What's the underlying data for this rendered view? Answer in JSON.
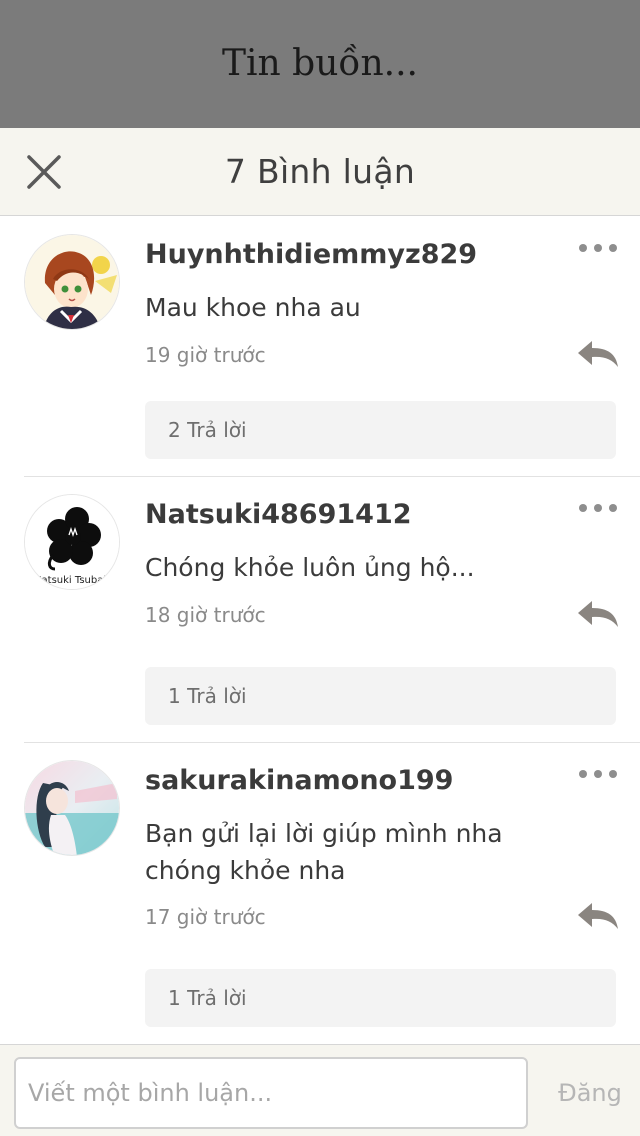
{
  "story": {
    "title": "Tin buồn..."
  },
  "comments_header": {
    "title": "7 Bình luận",
    "close_icon": "close-icon"
  },
  "comments": [
    {
      "username": "Huynhthidiemmyz829",
      "text": "Mau khoe nha au",
      "time": "19 giờ trước",
      "replies_label": "2 Trả lời"
    },
    {
      "username": "Natsuki48691412",
      "text": "Chóng khỏe luôn ủng hộ...",
      "time": "18 giờ trước",
      "replies_label": "1 Trả lời",
      "avatar_caption": "Natsuki Tsubaki"
    },
    {
      "username": "sakurakinamono199",
      "text": "Bạn gửi lại lời giúp mình nha chóng khỏe nha",
      "time": "17 giờ trước",
      "replies_label": "1 Trả lời"
    }
  ],
  "composer": {
    "placeholder": "Viết một bình luận...",
    "post_label": "Đăng"
  },
  "colors": {
    "header_bg": "#7b7b7b",
    "bar_bg": "#f6f5ef",
    "reply_icon": "#8a8580",
    "text": "#3b3b3b",
    "muted": "#8a8a8a"
  },
  "icons": [
    "close-icon",
    "more-options-icon",
    "reply-arrow-icon"
  ]
}
